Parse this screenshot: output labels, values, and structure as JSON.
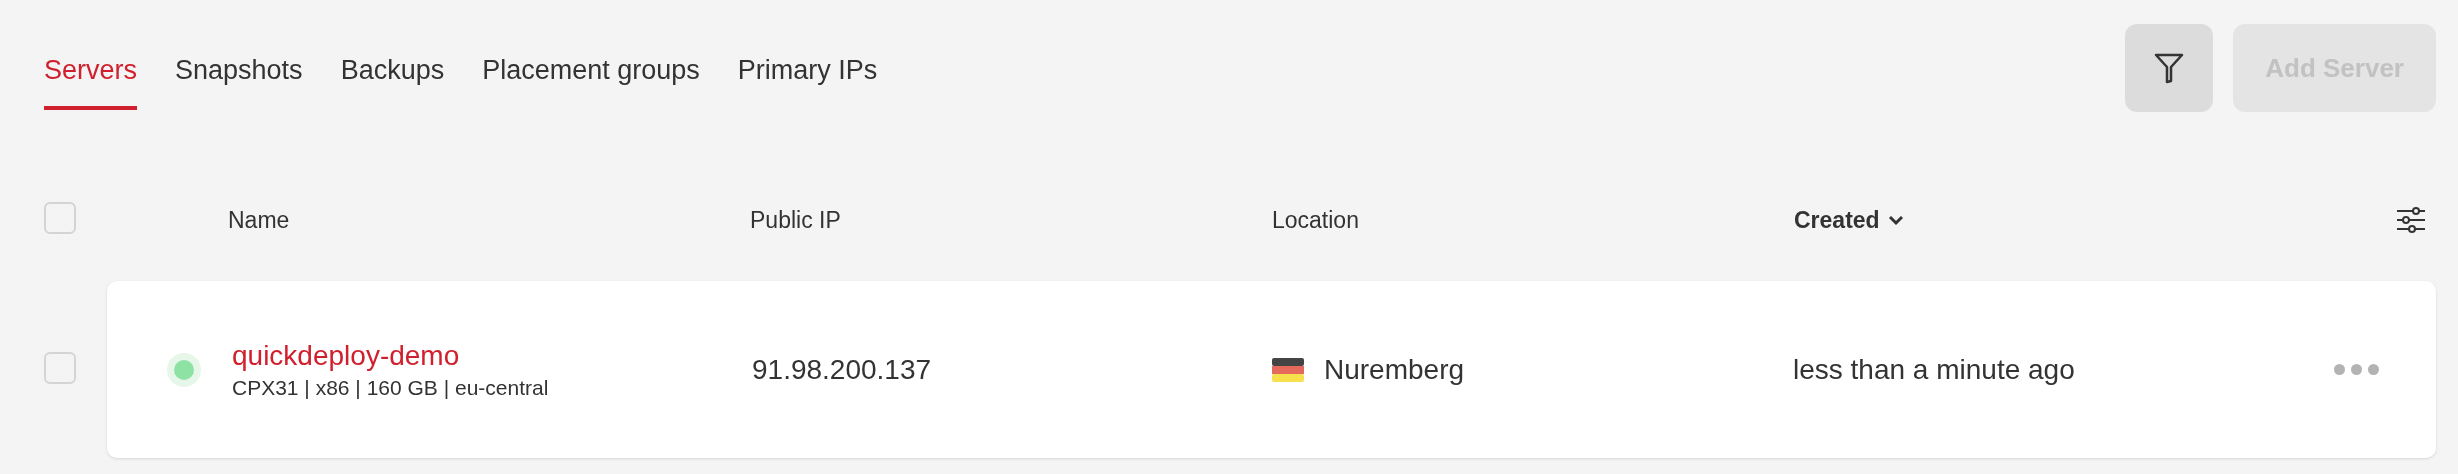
{
  "tabs": [
    {
      "label": "Servers",
      "selected": true
    },
    {
      "label": "Snapshots",
      "selected": false
    },
    {
      "label": "Backups",
      "selected": false
    },
    {
      "label": "Placement groups",
      "selected": false
    },
    {
      "label": "Primary IPs",
      "selected": false
    }
  ],
  "toolbar": {
    "filter_button": {
      "disabled": false
    },
    "add_button": {
      "label": "Add Server",
      "disabled": true
    }
  },
  "table": {
    "select_all": {
      "checked": false
    },
    "columns": [
      {
        "label": "Name",
        "sorted": false
      },
      {
        "label": "Public IP",
        "sorted": false
      },
      {
        "label": "Location",
        "sorted": false
      },
      {
        "label": "Created",
        "sorted": true
      }
    ],
    "rows": [
      {
        "checked": false,
        "running": true,
        "name": "quickdeploy-demo",
        "details": "CPX31 | x86 | 160 GB | eu-central",
        "public_ip": "91.98.200.137",
        "location": "Nuremberg",
        "created": "less than a minute ago"
      }
    ]
  }
}
